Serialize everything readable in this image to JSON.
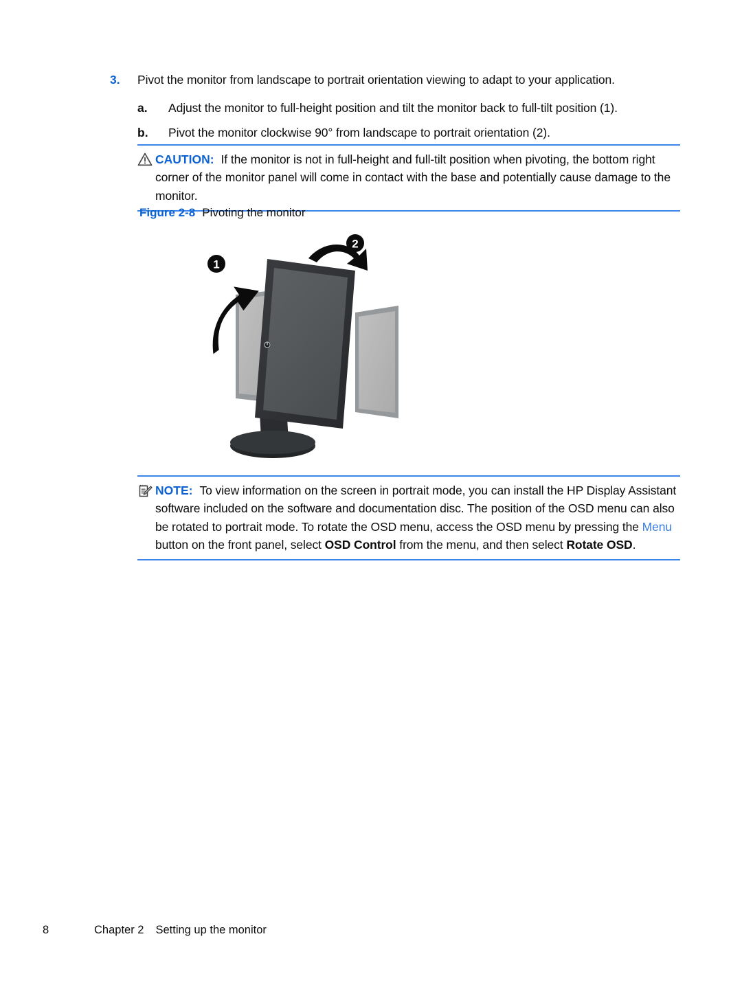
{
  "page": {
    "background": "#ffffff",
    "accent_blue": "#0d62d1",
    "rule_blue": "#3b86e8",
    "link_blue": "#3b7ddd"
  },
  "step": {
    "number": "3.",
    "text": "Pivot the monitor from landscape to portrait orientation viewing to adapt to your application."
  },
  "substeps": [
    {
      "letter": "a.",
      "text": "Adjust the monitor to full-height position and tilt the monitor back to full-tilt position (1)."
    },
    {
      "letter": "b.",
      "text": "Pivot the monitor clockwise 90° from landscape to portrait orientation (2)."
    }
  ],
  "caution": {
    "icon": "warning-triangle-icon",
    "label": "CAUTION:",
    "text": "If the monitor is not in full-height and full-tilt position when pivoting, the bottom right corner of the monitor panel will come in contact with the base and potentially cause damage to the monitor."
  },
  "figure": {
    "label": "Figure 2-8",
    "title": "Pivoting the monitor",
    "callouts": [
      {
        "number": "1",
        "meaning": "raise-and-tilt-arrow"
      },
      {
        "number": "2",
        "meaning": "rotate-clockwise-arrow"
      }
    ],
    "illustration_alt": "Monitor shown pivoting from landscape to portrait orientation on its stand"
  },
  "note": {
    "icon": "note-pad-pencil-icon",
    "label": "NOTE:",
    "segments": [
      {
        "type": "plain",
        "text": "To view information on the screen in portrait mode, you can install the HP Display Assistant software included on the software and documentation disc. The position of the OSD menu can also be rotated to portrait mode. To rotate the OSD menu, access the OSD menu by pressing the "
      },
      {
        "type": "link",
        "text": "Menu"
      },
      {
        "type": "plain",
        "text": " button on the front panel, select "
      },
      {
        "type": "strong",
        "text": "OSD Control"
      },
      {
        "type": "plain",
        "text": " from the menu, and then select "
      },
      {
        "type": "strong",
        "text": "Rotate OSD"
      },
      {
        "type": "plain",
        "text": "."
      }
    ]
  },
  "footer": {
    "page_number": "8",
    "chapter": "Chapter 2",
    "chapter_title": "Setting up the monitor"
  }
}
